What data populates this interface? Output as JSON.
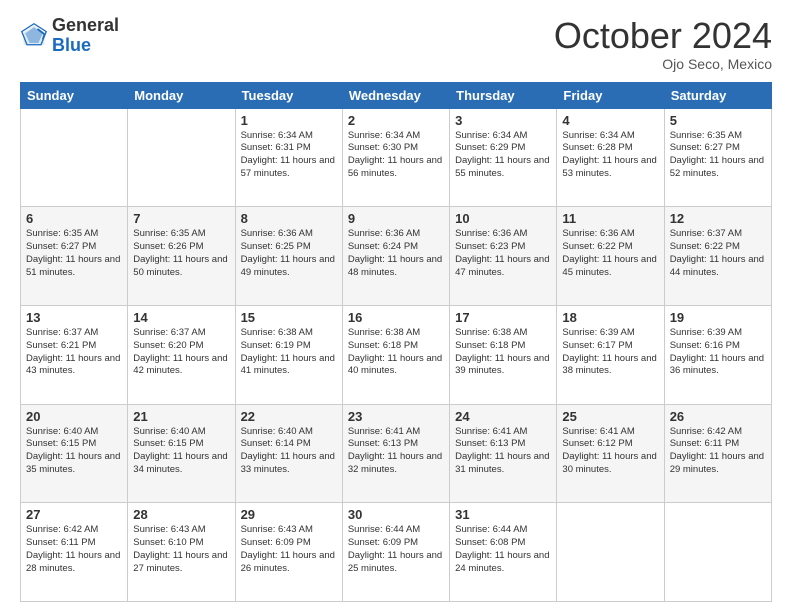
{
  "header": {
    "logo_general": "General",
    "logo_blue": "Blue",
    "month_title": "October 2024",
    "subtitle": "Ojo Seco, Mexico"
  },
  "weekdays": [
    "Sunday",
    "Monday",
    "Tuesday",
    "Wednesday",
    "Thursday",
    "Friday",
    "Saturday"
  ],
  "weeks": [
    [
      null,
      null,
      {
        "day": "1",
        "sunrise": "6:34 AM",
        "sunset": "6:31 PM",
        "daylight": "11 hours and 57 minutes."
      },
      {
        "day": "2",
        "sunrise": "6:34 AM",
        "sunset": "6:30 PM",
        "daylight": "11 hours and 56 minutes."
      },
      {
        "day": "3",
        "sunrise": "6:34 AM",
        "sunset": "6:29 PM",
        "daylight": "11 hours and 55 minutes."
      },
      {
        "day": "4",
        "sunrise": "6:34 AM",
        "sunset": "6:28 PM",
        "daylight": "11 hours and 53 minutes."
      },
      {
        "day": "5",
        "sunrise": "6:35 AM",
        "sunset": "6:27 PM",
        "daylight": "11 hours and 52 minutes."
      }
    ],
    [
      {
        "day": "6",
        "sunrise": "6:35 AM",
        "sunset": "6:27 PM",
        "daylight": "11 hours and 51 minutes."
      },
      {
        "day": "7",
        "sunrise": "6:35 AM",
        "sunset": "6:26 PM",
        "daylight": "11 hours and 50 minutes."
      },
      {
        "day": "8",
        "sunrise": "6:36 AM",
        "sunset": "6:25 PM",
        "daylight": "11 hours and 49 minutes."
      },
      {
        "day": "9",
        "sunrise": "6:36 AM",
        "sunset": "6:24 PM",
        "daylight": "11 hours and 48 minutes."
      },
      {
        "day": "10",
        "sunrise": "6:36 AM",
        "sunset": "6:23 PM",
        "daylight": "11 hours and 47 minutes."
      },
      {
        "day": "11",
        "sunrise": "6:36 AM",
        "sunset": "6:22 PM",
        "daylight": "11 hours and 45 minutes."
      },
      {
        "day": "12",
        "sunrise": "6:37 AM",
        "sunset": "6:22 PM",
        "daylight": "11 hours and 44 minutes."
      }
    ],
    [
      {
        "day": "13",
        "sunrise": "6:37 AM",
        "sunset": "6:21 PM",
        "daylight": "11 hours and 43 minutes."
      },
      {
        "day": "14",
        "sunrise": "6:37 AM",
        "sunset": "6:20 PM",
        "daylight": "11 hours and 42 minutes."
      },
      {
        "day": "15",
        "sunrise": "6:38 AM",
        "sunset": "6:19 PM",
        "daylight": "11 hours and 41 minutes."
      },
      {
        "day": "16",
        "sunrise": "6:38 AM",
        "sunset": "6:18 PM",
        "daylight": "11 hours and 40 minutes."
      },
      {
        "day": "17",
        "sunrise": "6:38 AM",
        "sunset": "6:18 PM",
        "daylight": "11 hours and 39 minutes."
      },
      {
        "day": "18",
        "sunrise": "6:39 AM",
        "sunset": "6:17 PM",
        "daylight": "11 hours and 38 minutes."
      },
      {
        "day": "19",
        "sunrise": "6:39 AM",
        "sunset": "6:16 PM",
        "daylight": "11 hours and 36 minutes."
      }
    ],
    [
      {
        "day": "20",
        "sunrise": "6:40 AM",
        "sunset": "6:15 PM",
        "daylight": "11 hours and 35 minutes."
      },
      {
        "day": "21",
        "sunrise": "6:40 AM",
        "sunset": "6:15 PM",
        "daylight": "11 hours and 34 minutes."
      },
      {
        "day": "22",
        "sunrise": "6:40 AM",
        "sunset": "6:14 PM",
        "daylight": "11 hours and 33 minutes."
      },
      {
        "day": "23",
        "sunrise": "6:41 AM",
        "sunset": "6:13 PM",
        "daylight": "11 hours and 32 minutes."
      },
      {
        "day": "24",
        "sunrise": "6:41 AM",
        "sunset": "6:13 PM",
        "daylight": "11 hours and 31 minutes."
      },
      {
        "day": "25",
        "sunrise": "6:41 AM",
        "sunset": "6:12 PM",
        "daylight": "11 hours and 30 minutes."
      },
      {
        "day": "26",
        "sunrise": "6:42 AM",
        "sunset": "6:11 PM",
        "daylight": "11 hours and 29 minutes."
      }
    ],
    [
      {
        "day": "27",
        "sunrise": "6:42 AM",
        "sunset": "6:11 PM",
        "daylight": "11 hours and 28 minutes."
      },
      {
        "day": "28",
        "sunrise": "6:43 AM",
        "sunset": "6:10 PM",
        "daylight": "11 hours and 27 minutes."
      },
      {
        "day": "29",
        "sunrise": "6:43 AM",
        "sunset": "6:09 PM",
        "daylight": "11 hours and 26 minutes."
      },
      {
        "day": "30",
        "sunrise": "6:44 AM",
        "sunset": "6:09 PM",
        "daylight": "11 hours and 25 minutes."
      },
      {
        "day": "31",
        "sunrise": "6:44 AM",
        "sunset": "6:08 PM",
        "daylight": "11 hours and 24 minutes."
      },
      null,
      null
    ]
  ]
}
